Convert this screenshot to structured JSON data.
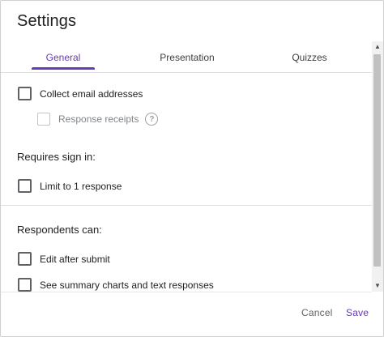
{
  "dialog": {
    "title": "Settings"
  },
  "tabs": [
    {
      "label": "General",
      "active": true
    },
    {
      "label": "Presentation",
      "active": false
    },
    {
      "label": "Quizzes",
      "active": false
    }
  ],
  "general": {
    "collect_email": {
      "label": "Collect email addresses",
      "checked": false
    },
    "response_receipts": {
      "label": "Response receipts",
      "checked": false,
      "disabled": true,
      "help_icon": "help-circle-icon",
      "help_glyph": "?"
    },
    "requires_sign_in_heading": "Requires sign in:",
    "limit_one_response": {
      "label": "Limit to 1 response",
      "checked": false
    },
    "respondents_can_heading": "Respondents can:",
    "edit_after_submit": {
      "label": "Edit after submit",
      "checked": false
    },
    "see_summary": {
      "label": "See summary charts and text responses",
      "checked": false
    }
  },
  "footer": {
    "cancel_label": "Cancel",
    "save_label": "Save"
  },
  "colors": {
    "accent": "#673ab7",
    "text": "#202124",
    "muted": "#5f6368"
  }
}
